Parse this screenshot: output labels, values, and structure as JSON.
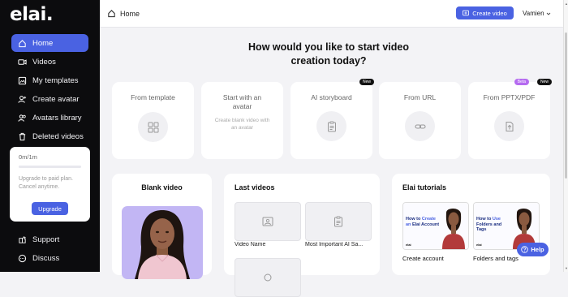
{
  "brand": {
    "logo": "elai.",
    "accent": "#4a62e2"
  },
  "sidebar": {
    "items": [
      {
        "label": "Home",
        "icon": "home-icon",
        "active": true
      },
      {
        "label": "Videos",
        "icon": "video-camera-icon"
      },
      {
        "label": "My templates",
        "icon": "templates-icon"
      },
      {
        "label": "Create avatar",
        "icon": "create-avatar-icon"
      },
      {
        "label": "Avatars library",
        "icon": "avatars-library-icon"
      },
      {
        "label": "Deleted videos",
        "icon": "trash-icon"
      }
    ],
    "plan": {
      "minutes": "0m/1m",
      "usage_fraction": 0,
      "note": "Upgrade to paid plan. Cancel anytime.",
      "upgrade_label": "Upgrade"
    },
    "bottom_items": [
      {
        "label": "Support",
        "icon": "support-icon"
      },
      {
        "label": "Discuss",
        "icon": "chat-icon"
      }
    ]
  },
  "header": {
    "breadcrumb": "Home",
    "create_label": "Create video",
    "user": "Vamien"
  },
  "main": {
    "headline": "How would you like to start video creation today?",
    "options": [
      {
        "title": "From template",
        "icon": "grid-icon"
      },
      {
        "title": "Start with an avatar",
        "subtitle": "Create blank video with an avatar"
      },
      {
        "title": "AI storyboard",
        "icon": "clipboard-icon",
        "badge": "New"
      },
      {
        "title": "From URL",
        "icon": "link-icon"
      },
      {
        "title": "From PPTX/PDF",
        "icon": "file-upload-icon",
        "badge_beta": "Beta",
        "badge": "New"
      }
    ],
    "blank_video": {
      "title": "Blank video"
    },
    "last_videos": {
      "title": "Last videos",
      "items": [
        {
          "name": "Video Name",
          "icon": "image-icon"
        },
        {
          "name": "Most Important AI Sa...",
          "icon": "clipboard-icon"
        }
      ]
    },
    "tutorials": {
      "title": "Elai tutorials",
      "items": [
        {
          "pre": "How to",
          "highlight": "Create an",
          "post": "Elai Account",
          "logo": "elai",
          "caption": "Create account"
        },
        {
          "pre": "How to",
          "highlight": "Use",
          "post": "Folders and Tags",
          "logo": "elai",
          "caption": "Folders and tags"
        }
      ]
    }
  },
  "help_label": "Help"
}
